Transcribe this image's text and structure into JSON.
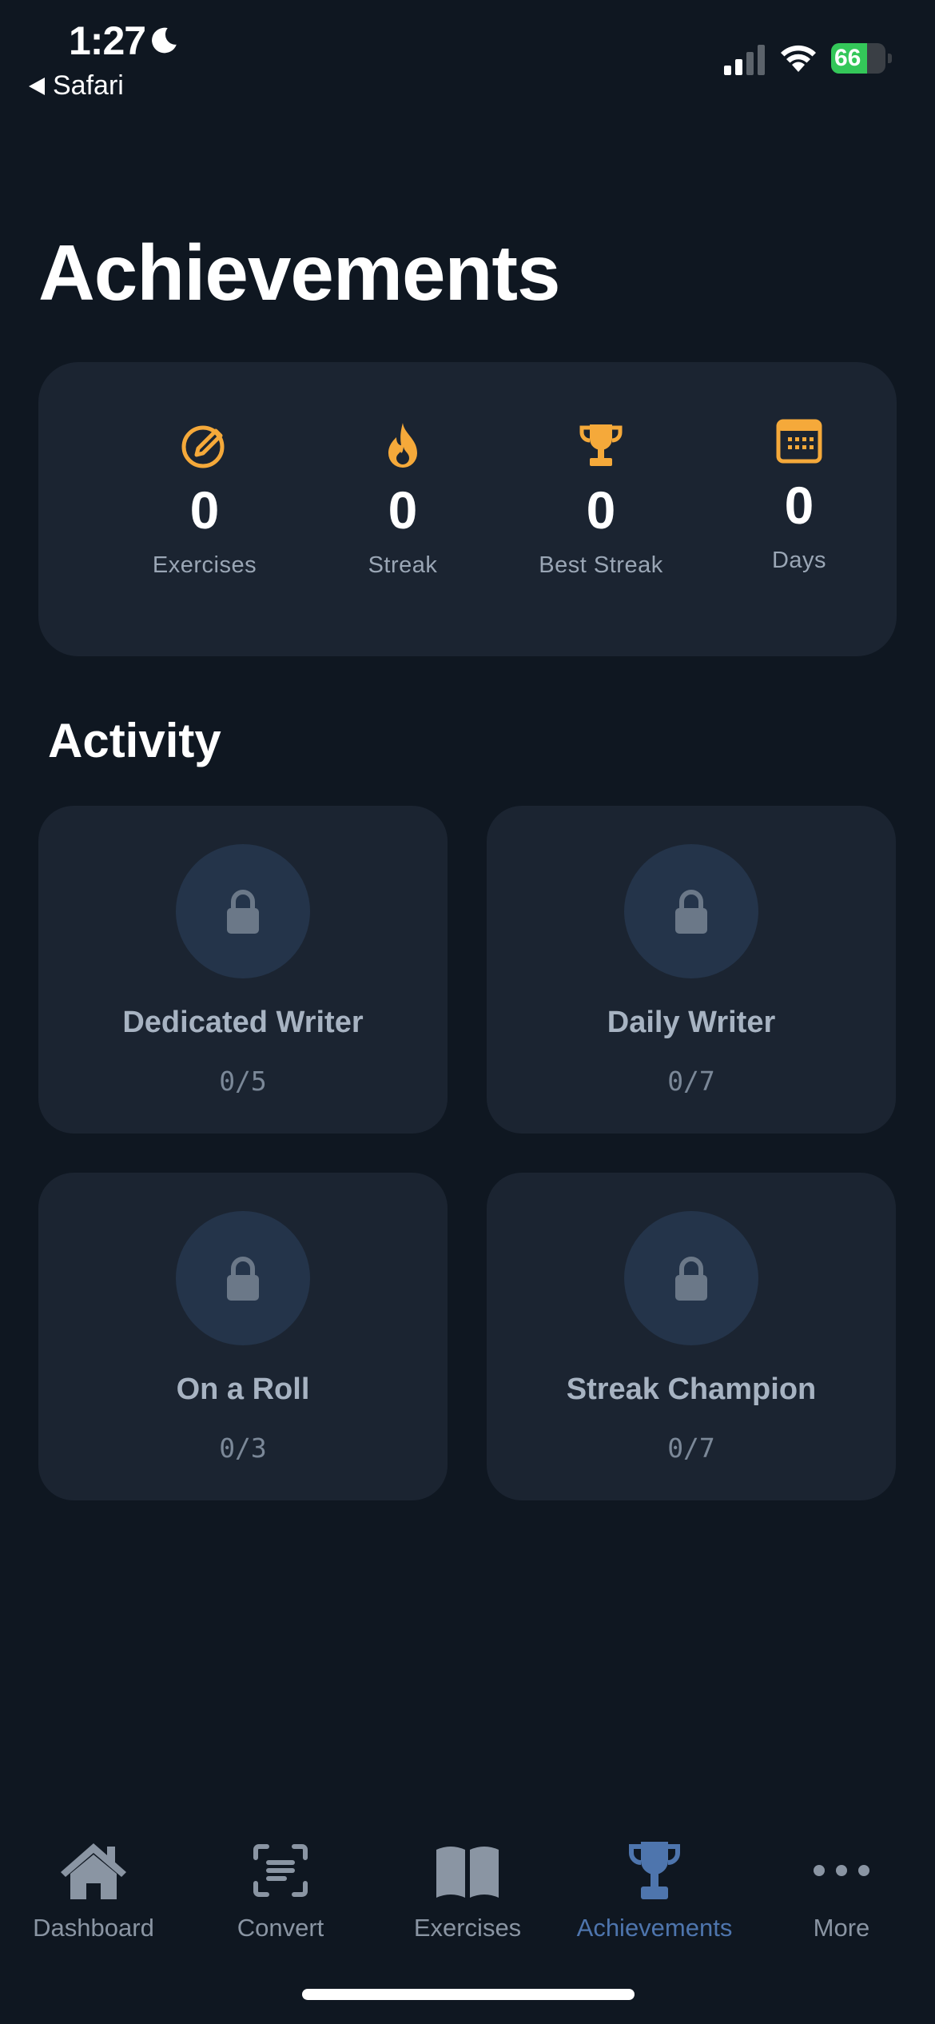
{
  "status_bar": {
    "time": "1:27",
    "back_label": "Safari",
    "battery_percent": "66",
    "battery_level": 0.66
  },
  "page": {
    "title": "Achievements"
  },
  "stats": [
    {
      "icon": "pencil-circle-icon",
      "value": "0",
      "label": "Exercises"
    },
    {
      "icon": "flame-icon",
      "value": "0",
      "label": "Streak"
    },
    {
      "icon": "trophy-icon",
      "value": "0",
      "label": "Best Streak"
    },
    {
      "icon": "calendar-icon",
      "value": "0",
      "label": "Days"
    }
  ],
  "activity": {
    "title": "Activity",
    "items": [
      {
        "name": "Dedicated Writer",
        "progress": "0/5",
        "icon": "lock-icon"
      },
      {
        "name": "Daily Writer",
        "progress": "0/7",
        "icon": "lock-icon"
      },
      {
        "name": "On a Roll",
        "progress": "0/3",
        "icon": "lock-icon"
      },
      {
        "name": "Streak Champion",
        "progress": "0/7",
        "icon": "lock-icon"
      }
    ]
  },
  "tabs": [
    {
      "label": "Dashboard",
      "icon": "house-icon",
      "active": false
    },
    {
      "label": "Convert",
      "icon": "scan-text-icon",
      "active": false
    },
    {
      "label": "Exercises",
      "icon": "book-icon",
      "active": false
    },
    {
      "label": "Achievements",
      "icon": "trophy-icon",
      "active": true
    },
    {
      "label": "More",
      "icon": "ellipsis-icon",
      "active": false
    }
  ],
  "colors": {
    "background": "#0f1721",
    "card": "#1b2431",
    "accent_orange": "#f5a93a",
    "tab_active": "#4e75ad",
    "battery_green": "#34c759"
  }
}
